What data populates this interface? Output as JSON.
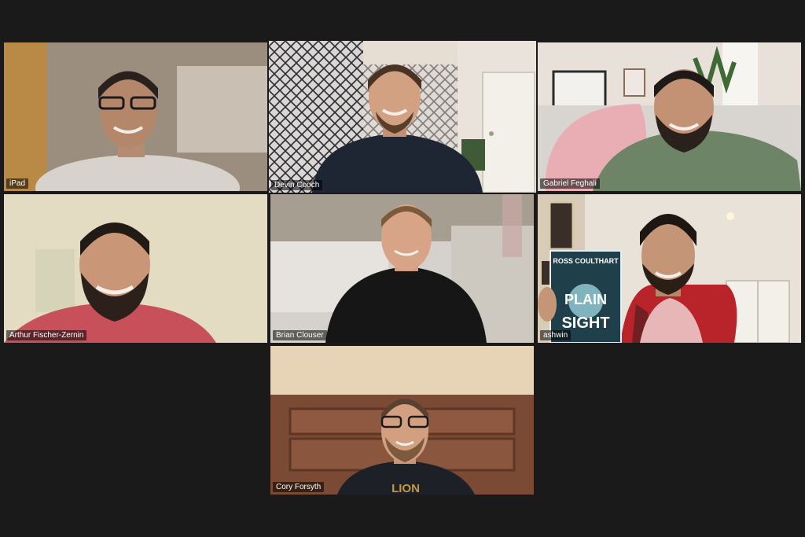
{
  "meeting": {
    "participants": [
      {
        "name": "iPad",
        "active": false
      },
      {
        "name": "Devin Cooch",
        "active": true
      },
      {
        "name": "Gabriel Feghali",
        "active": false
      },
      {
        "name": "Arthur Fischer-Zernin",
        "active": false
      },
      {
        "name": "Brian Clouser",
        "active": false
      },
      {
        "name": "ashwin",
        "active": false
      },
      {
        "name": "Cory Forsyth",
        "active": false
      }
    ],
    "book": {
      "author": "ROSS COULTHART",
      "title_line1": "PLAIN",
      "title_line2": "SIGHT"
    },
    "shirt_text": "LION"
  },
  "colors": {
    "background": "#1a1a1a",
    "active_speaker_border": "#c7e84a"
  }
}
